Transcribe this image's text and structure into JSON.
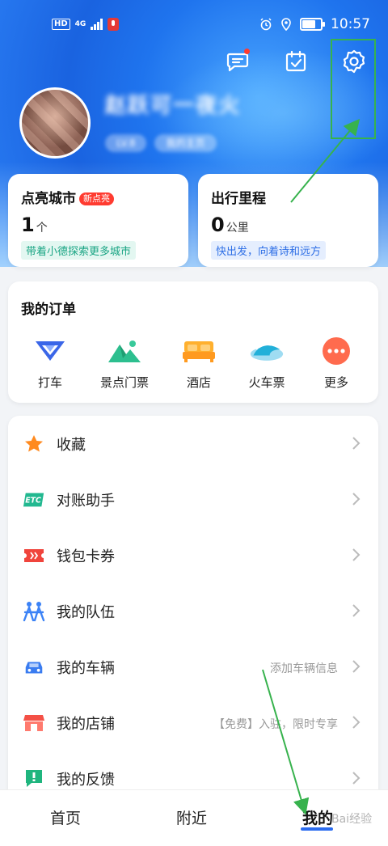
{
  "statusbar": {
    "left_chip": "HD",
    "network": "4G",
    "time": "10:57",
    "battery_level": 0.8
  },
  "header": {
    "nickname": "赵跃可一夜火",
    "tags": [
      "LV.8",
      "我的主页"
    ],
    "icons": [
      "message-icon",
      "checkin-icon",
      "settings-icon"
    ]
  },
  "stats": {
    "cities": {
      "title": "点亮城市",
      "badge": "新点亮",
      "value": "1",
      "unit": "个",
      "sub": "带着小德探索更多城市"
    },
    "mileage": {
      "title": "出行里程",
      "value": "0",
      "unit": "公里",
      "sub": "快出发，向着诗和远方"
    }
  },
  "orders": {
    "title": "我的订单",
    "items": [
      {
        "label": "打车",
        "icon": "taxi-icon"
      },
      {
        "label": "景点门票",
        "icon": "scenic-icon"
      },
      {
        "label": "酒店",
        "icon": "hotel-icon"
      },
      {
        "label": "火车票",
        "icon": "train-icon"
      },
      {
        "label": "更多",
        "icon": "more-icon"
      }
    ]
  },
  "menu": [
    {
      "label": "收藏",
      "hint": "",
      "icon": "star-icon"
    },
    {
      "label": "对账助手",
      "hint": "",
      "icon": "etc-icon"
    },
    {
      "label": "钱包卡券",
      "hint": "",
      "icon": "coupon-icon"
    },
    {
      "label": "我的队伍",
      "hint": "",
      "icon": "team-icon"
    },
    {
      "label": "我的车辆",
      "hint": "添加车辆信息",
      "icon": "car-icon"
    },
    {
      "label": "我的店铺",
      "hint": "【免费】入驻，限时专享",
      "icon": "shop-icon"
    },
    {
      "label": "我的反馈",
      "hint": "",
      "icon": "feedback-icon"
    }
  ],
  "tabbar": {
    "items": [
      "首页",
      "附近",
      "我的"
    ],
    "active": 2
  },
  "watermark": "Bai经验",
  "colors": {
    "primary": "#1f74ee",
    "highlight": "#37b24d",
    "badge": "#ff3b30"
  }
}
